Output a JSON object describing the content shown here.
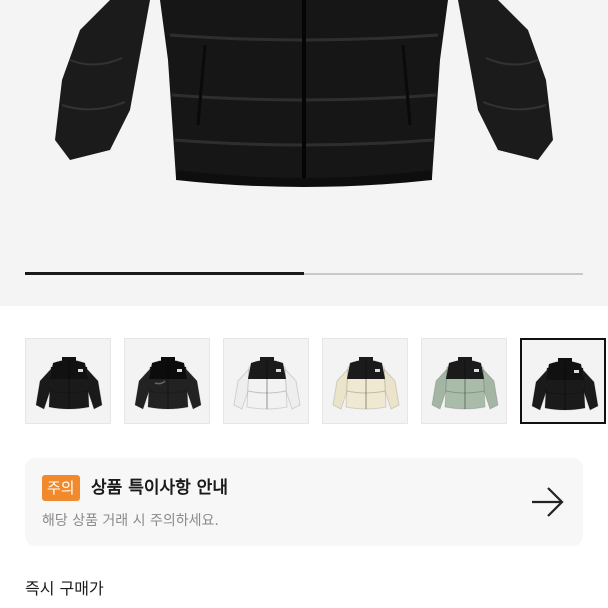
{
  "gallery": {
    "slide_progress": 0.5,
    "thumbnails": [
      {
        "name": "thumb-black-jacket",
        "color": "black",
        "selected": false
      },
      {
        "name": "thumb-black-glossy-jacket",
        "color": "glossy-black",
        "selected": false
      },
      {
        "name": "thumb-white-jacket",
        "color": "white-black",
        "selected": false
      },
      {
        "name": "thumb-cream-jacket",
        "color": "cream-black",
        "selected": false
      },
      {
        "name": "thumb-sage-jacket",
        "color": "sage-black",
        "selected": false
      },
      {
        "name": "thumb-black-jacket-2",
        "color": "black",
        "selected": true
      }
    ]
  },
  "notice": {
    "badge": "주의",
    "title": "상품 특이사항 안내",
    "description": "해당 상품 거래 시 주의하세요.",
    "arrow_icon": "arrow-right-icon",
    "badge_color": "#f08a2c"
  },
  "purchase": {
    "label": "즉시 구매가"
  }
}
